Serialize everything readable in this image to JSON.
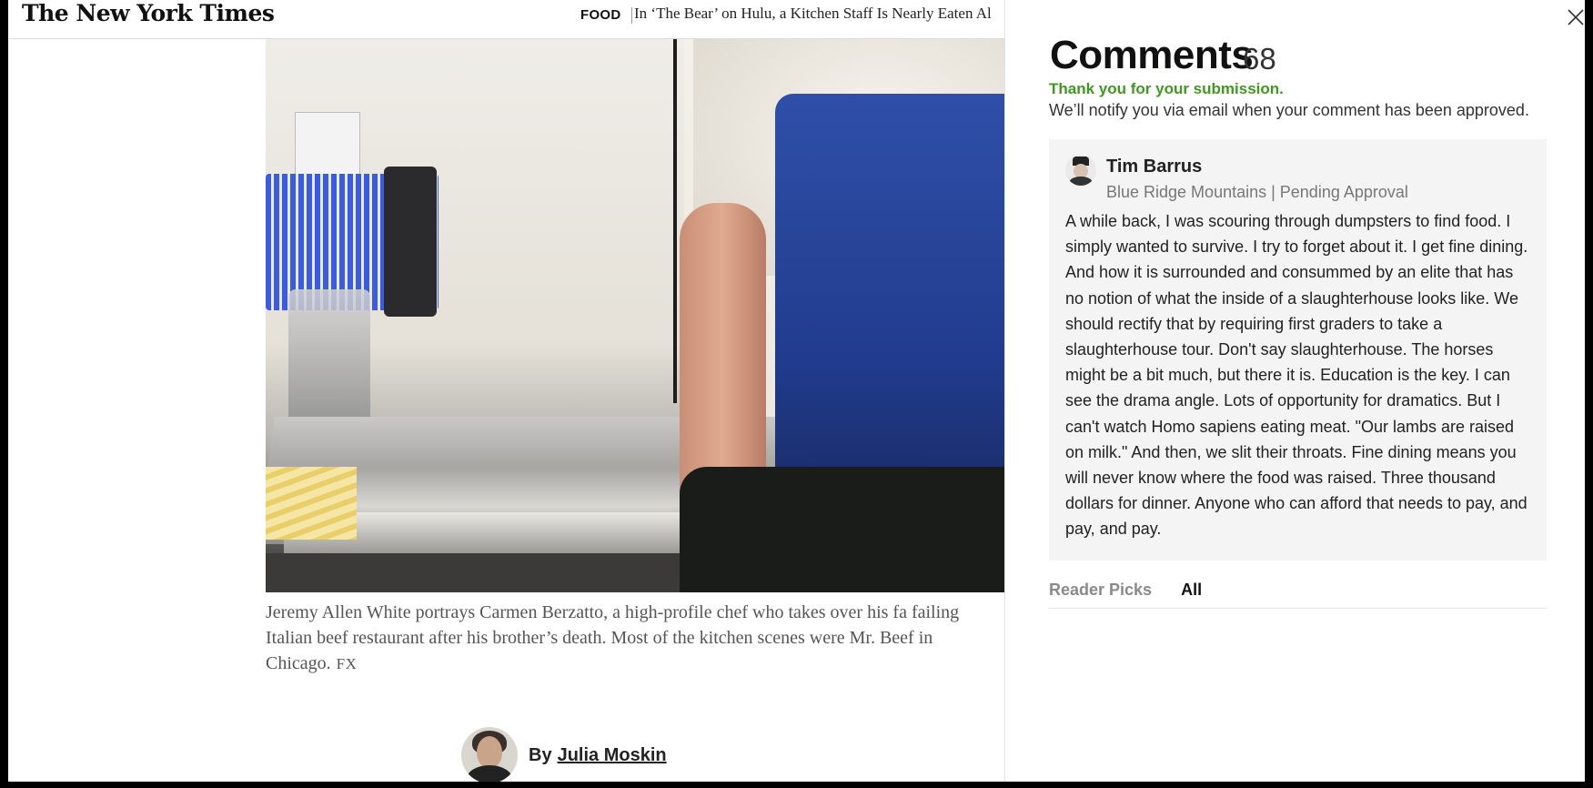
{
  "article": {
    "logo": "The New York Times",
    "section": "FOOD",
    "headline": "In ‘The Bear’ on Hulu, a Kitchen Staff Is Nearly Eaten Al",
    "caption": "Jeremy Allen White portrays Carmen Berzatto, a high-profile chef who takes over his fa failing Italian beef restaurant after his brother’s death. Most of the kitchen scenes were Mr. Beef in Chicago.",
    "caption_credit": "FX",
    "byline_prefix": "By",
    "author": "Julia Moskin"
  },
  "comments": {
    "title": "Comments",
    "count": "68",
    "thanks": "Thank you for your submission.",
    "notify": "We’ll notify you via email when your comment has been approved.",
    "comment": {
      "name": "Tim Barrus",
      "meta": "Blue Ridge Mountains | Pending Approval",
      "body": "A while back, I was scouring through dumpsters to find food. I simply wanted to survive. I try to forget about it. I get fine dining. And how it is surrounded and consummed by an elite that has no notion of what the inside of a slaughterhouse looks like. We should rectify that by requiring first graders to take a slaughterhouse tour. Don't say slaughterhouse. The horses might be a bit much, but there it is. Education is the key. I can see the drama angle. Lots of opportunity for dramatics. But I can't watch Homo sapiens eating meat. \"Our lambs are raised on milk.\" And then, we slit their throats. Fine dining means you will never know where the food was raised. Three thousand dollars for dinner. Anyone who can afford that needs to pay, and pay, and pay."
    },
    "tabs": [
      {
        "label": "Reader Picks",
        "active": false
      },
      {
        "label": "All",
        "active": true
      }
    ],
    "close_icon": "close-icon"
  },
  "colors": {
    "accent_green": "#3d9a1d",
    "card_bg": "#f4f4f4",
    "apron_blue": "#213c8e"
  }
}
